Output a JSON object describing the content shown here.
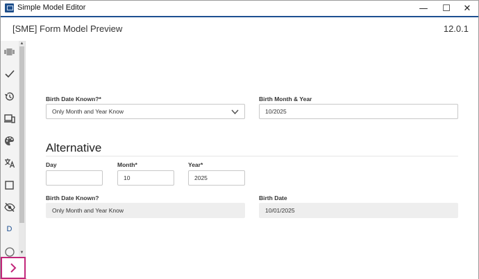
{
  "window": {
    "title": "Simple Model Editor",
    "controls": {
      "minimize": "—",
      "maximize": "☐",
      "close": "✕"
    }
  },
  "header": {
    "title": "[SME] Form Model Preview",
    "version": "12.0.1"
  },
  "sidebar": {
    "items": [
      {
        "name": "components-icon",
        "glyph": "▮▮"
      },
      {
        "name": "check-icon",
        "glyph": "✓"
      },
      {
        "name": "history-icon",
        "glyph": "↺"
      },
      {
        "name": "devices-icon",
        "glyph": "▭"
      },
      {
        "name": "palette-icon",
        "glyph": "◉"
      },
      {
        "name": "translate-icon",
        "glyph": "文A"
      },
      {
        "name": "square-icon",
        "glyph": "☐"
      },
      {
        "name": "visibility-off-icon",
        "glyph": "◎"
      },
      {
        "name": "d-icon",
        "glyph": "D"
      },
      {
        "name": "info-icon",
        "glyph": "◌"
      }
    ],
    "expand_glyph": "›"
  },
  "form": {
    "birth_known": {
      "label": "Birth Date Known?*",
      "value": "Only Month and Year Know"
    },
    "birth_month_year": {
      "label": "Birth Month & Year",
      "value": "10/2025"
    },
    "section_title": "Alternative",
    "day": {
      "label": "Day",
      "value": ""
    },
    "month": {
      "label": "Month*",
      "value": "10"
    },
    "year": {
      "label": "Year*",
      "value": "2025"
    },
    "birth_known_ro": {
      "label": "Birth Date Known?",
      "value": "Only Month and Year Know"
    },
    "birth_date": {
      "label": "Birth Date",
      "value": "10/01/2025"
    }
  }
}
